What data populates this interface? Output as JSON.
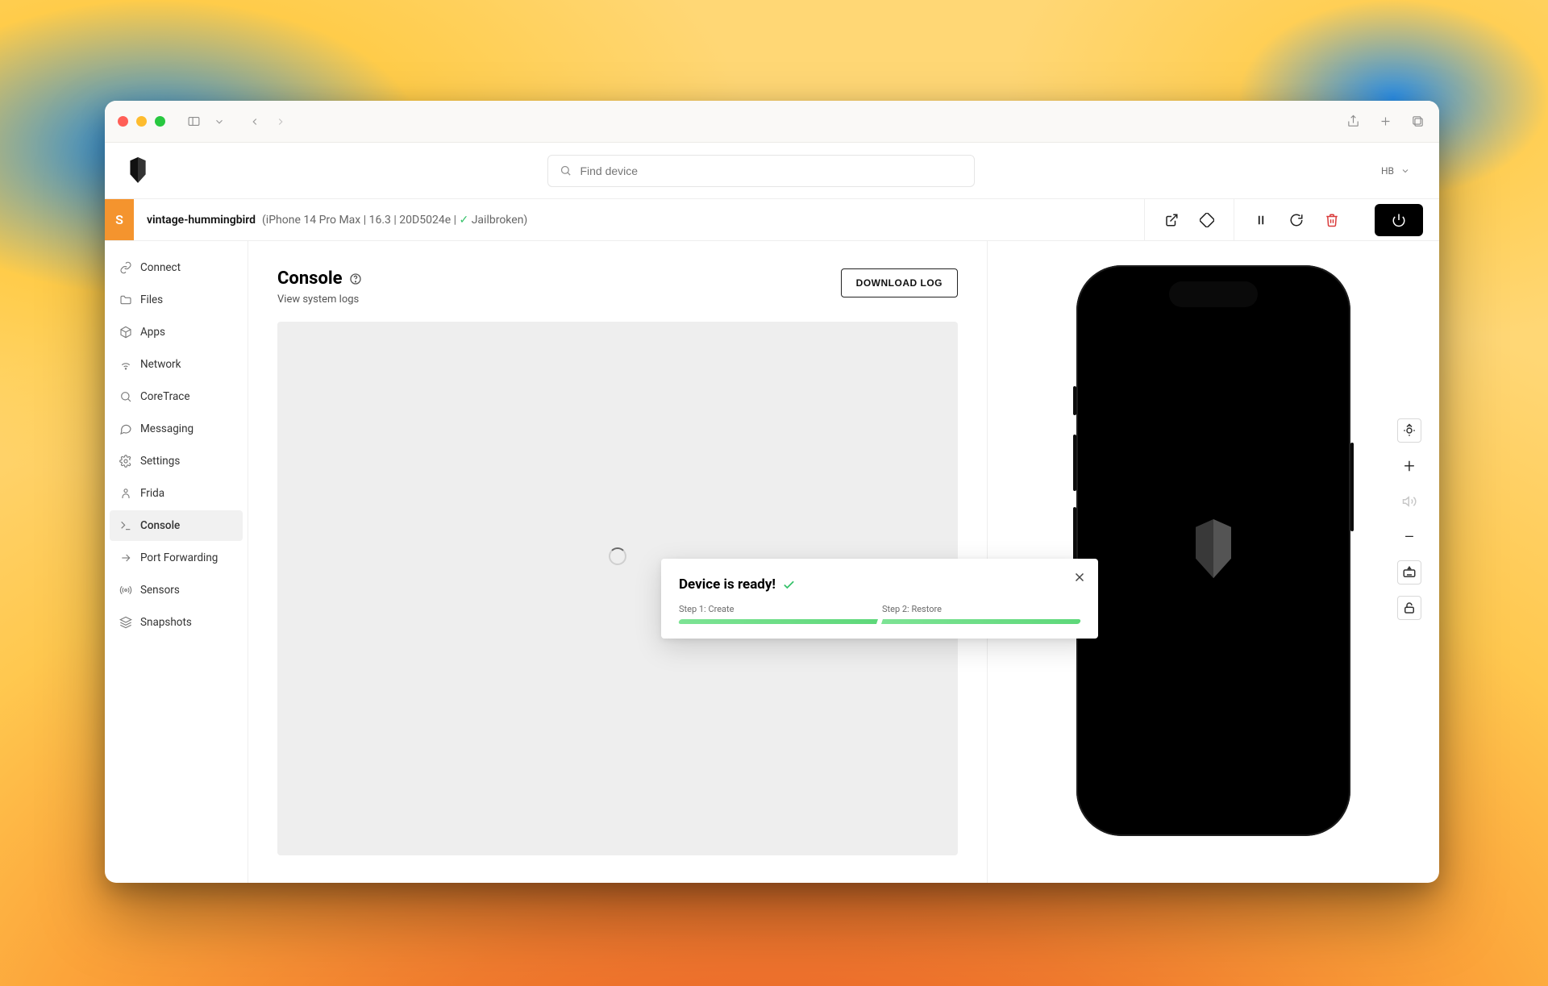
{
  "search": {
    "placeholder": "Find device"
  },
  "user": {
    "initials": "HB"
  },
  "tab": {
    "badge": "S",
    "name": "vintage-hummingbird",
    "meta_open": "(",
    "device": "iPhone 14 Pro Max",
    "sep": " | ",
    "os": "16.3",
    "build": "20D5024e",
    "status": "Jailbroken",
    "meta_close": ")"
  },
  "sidebar": {
    "items": [
      {
        "label": "Connect"
      },
      {
        "label": "Files"
      },
      {
        "label": "Apps"
      },
      {
        "label": "Network"
      },
      {
        "label": "CoreTrace"
      },
      {
        "label": "Messaging"
      },
      {
        "label": "Settings"
      },
      {
        "label": "Frida"
      },
      {
        "label": "Console"
      },
      {
        "label": "Port Forwarding"
      },
      {
        "label": "Sensors"
      },
      {
        "label": "Snapshots"
      }
    ]
  },
  "content": {
    "title": "Console",
    "subtitle": "View system logs",
    "download": "DOWNLOAD LOG"
  },
  "toast": {
    "title": "Device is ready!",
    "step1": "Step 1: Create",
    "step2": "Step 2: Restore"
  }
}
